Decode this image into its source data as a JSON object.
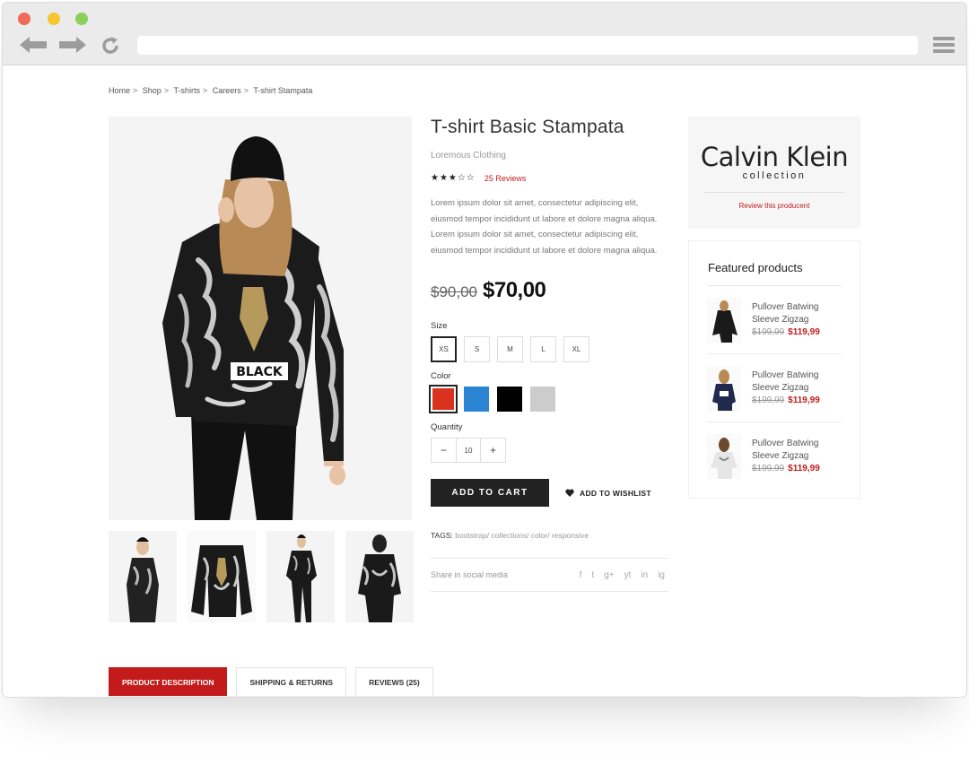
{
  "breadcrumb": [
    "Home",
    "Shop",
    "T-shirts",
    "Careers",
    "T-shirt Stampata"
  ],
  "breadcrumb_sep": ">",
  "product": {
    "title": "T-shirt Basic Stampata",
    "brand": "Loremous Clothing",
    "stars": "★★★☆☆",
    "reviews_link": "25 Reviews",
    "description": "Lorem ipsum dolor sit amet, consectetur adipiscing elit, eiusmod tempor incididunt ut labore et dolore magna aliqua. Lorem ipsum dolor sit amet, consectetur adipiscing elit, eiusmod tempor incididunt ut labore et dolore magna aliqua.",
    "old_price": "$90,00",
    "new_price": "$70,00",
    "image_text": "BLACK",
    "size_label": "Size",
    "sizes": [
      "XS",
      "S",
      "M",
      "L",
      "XL"
    ],
    "selected_size": "XS",
    "color_label": "Color",
    "colors": [
      "#d9321f",
      "#2a84d2",
      "#000000",
      "#cccccc"
    ],
    "quantity_label": "Quantity",
    "quantity_minus": "−",
    "quantity": "10",
    "quantity_plus": "+",
    "add_to_cart": "ADD TO CART",
    "wishlist": "ADD TO WISHLIST",
    "tags_label": "TAGS:",
    "tags": "bootstrap/ collections/ color/ responsive",
    "share_label": "Share in social media",
    "socials": [
      "f",
      "t",
      "g+",
      "yt",
      "in",
      "ig"
    ]
  },
  "brand_box": {
    "logo_main": "Calvin Klein",
    "logo_sub": "collection",
    "link": "Review this producent"
  },
  "featured": {
    "title": "Featured products",
    "items": [
      {
        "name_line1": "Pullover Batwing",
        "name_line2": "Sleeve Zigzag",
        "old_price": "$199,99",
        "new_price": "$119,99"
      },
      {
        "name_line1": "Pullover Batwing",
        "name_line2": "Sleeve Zigzag",
        "old_price": "$199,99",
        "new_price": "$119,99"
      },
      {
        "name_line1": "Pullover Batwing",
        "name_line2": "Sleeve Zigzag",
        "old_price": "$199,99",
        "new_price": "$119,99"
      }
    ]
  },
  "tabs": [
    "PRODUCT DESCRIPTION",
    "SHIPPING & RETURNS",
    "REVIEWS (25)"
  ],
  "accent": "#c31b1b"
}
